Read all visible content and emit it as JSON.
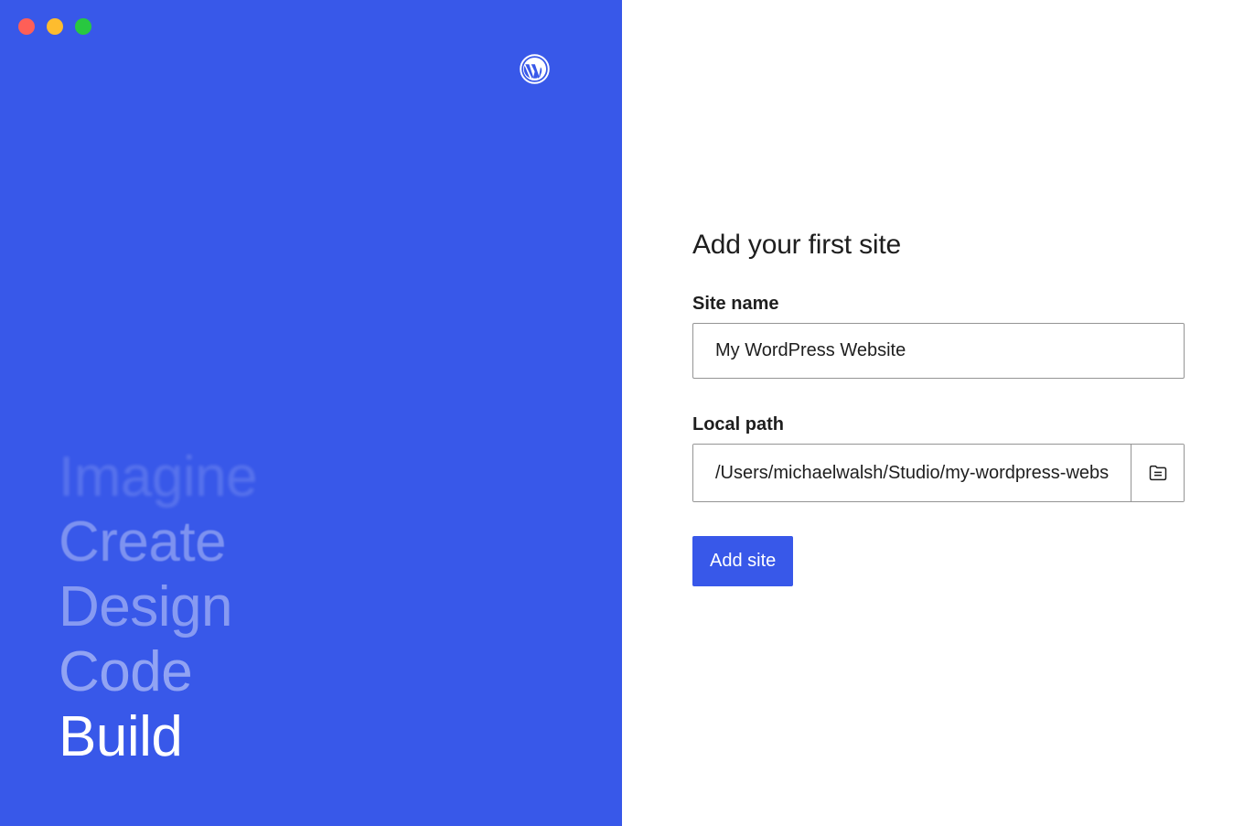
{
  "window": {
    "traffic_lights": {
      "close_color": "#fe5f57",
      "minimize_color": "#febc2e",
      "maximize_color": "#28c840"
    }
  },
  "brand": {
    "logo_icon": "wordpress-logo-icon",
    "panel_color": "#3858e9"
  },
  "tagline_words": [
    "Imagine",
    "Create",
    "Design",
    "Code",
    "Build"
  ],
  "form": {
    "heading": "Add your first site",
    "site_name_label": "Site name",
    "site_name_value": "My WordPress Website",
    "local_path_label": "Local path",
    "local_path_value": "/Users/michaelwalsh/Studio/my-wordpress-website",
    "browse_icon": "folder-icon",
    "submit_label": "Add site"
  }
}
